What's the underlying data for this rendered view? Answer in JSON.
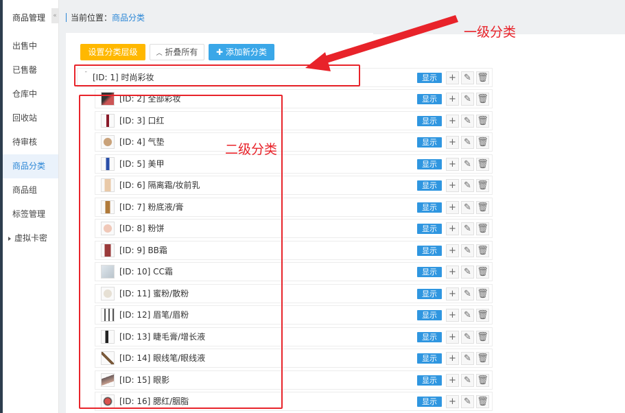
{
  "sidebar": {
    "title": "商品管理",
    "collapse": "«",
    "items": [
      {
        "label": "出售中",
        "active": false
      },
      {
        "label": "已售罄",
        "active": false
      },
      {
        "label": "仓库中",
        "active": false
      },
      {
        "label": "回收站",
        "active": false
      },
      {
        "label": "待审核",
        "active": false
      },
      {
        "label": "商品分类",
        "active": true
      },
      {
        "label": "商品组",
        "active": false
      },
      {
        "label": "标签管理",
        "active": false
      },
      {
        "label": "虚拟卡密",
        "active": false
      }
    ]
  },
  "breadcrumb": {
    "prefix": "当前位置：",
    "current": "商品分类"
  },
  "toolbar": {
    "set_level": "设置分类层级",
    "collapse_all": "折叠所有",
    "add_category": "添加新分类"
  },
  "tree": {
    "root": {
      "label": "[ID: 1] 时尚彩妆"
    },
    "children": [
      {
        "label": "[ID: 2] 全部彩妆"
      },
      {
        "label": "[ID: 3] 口红"
      },
      {
        "label": "[ID: 4] 气垫"
      },
      {
        "label": "[ID: 5] 美甲"
      },
      {
        "label": "[ID: 6] 隔离霜/妆前乳"
      },
      {
        "label": "[ID: 7] 粉底液/膏"
      },
      {
        "label": "[ID: 8] 粉饼"
      },
      {
        "label": "[ID: 9] BB霜"
      },
      {
        "label": "[ID: 10] CC霜"
      },
      {
        "label": "[ID: 11] 蜜粉/散粉"
      },
      {
        "label": "[ID: 12] 眉笔/眉粉"
      },
      {
        "label": "[ID: 13] 睫毛膏/增长液"
      },
      {
        "label": "[ID: 14] 眼线笔/眼线液"
      },
      {
        "label": "[ID: 15] 眼影"
      },
      {
        "label": "[ID: 16] 腮红/胭脂"
      }
    ],
    "show_label": "显示"
  },
  "annotations": {
    "level1": "一级分类",
    "level2": "二级分类"
  },
  "colors": {
    "accent": "#2a86d6",
    "annotation": "#e8232a",
    "primary_button": "#ffb800"
  }
}
